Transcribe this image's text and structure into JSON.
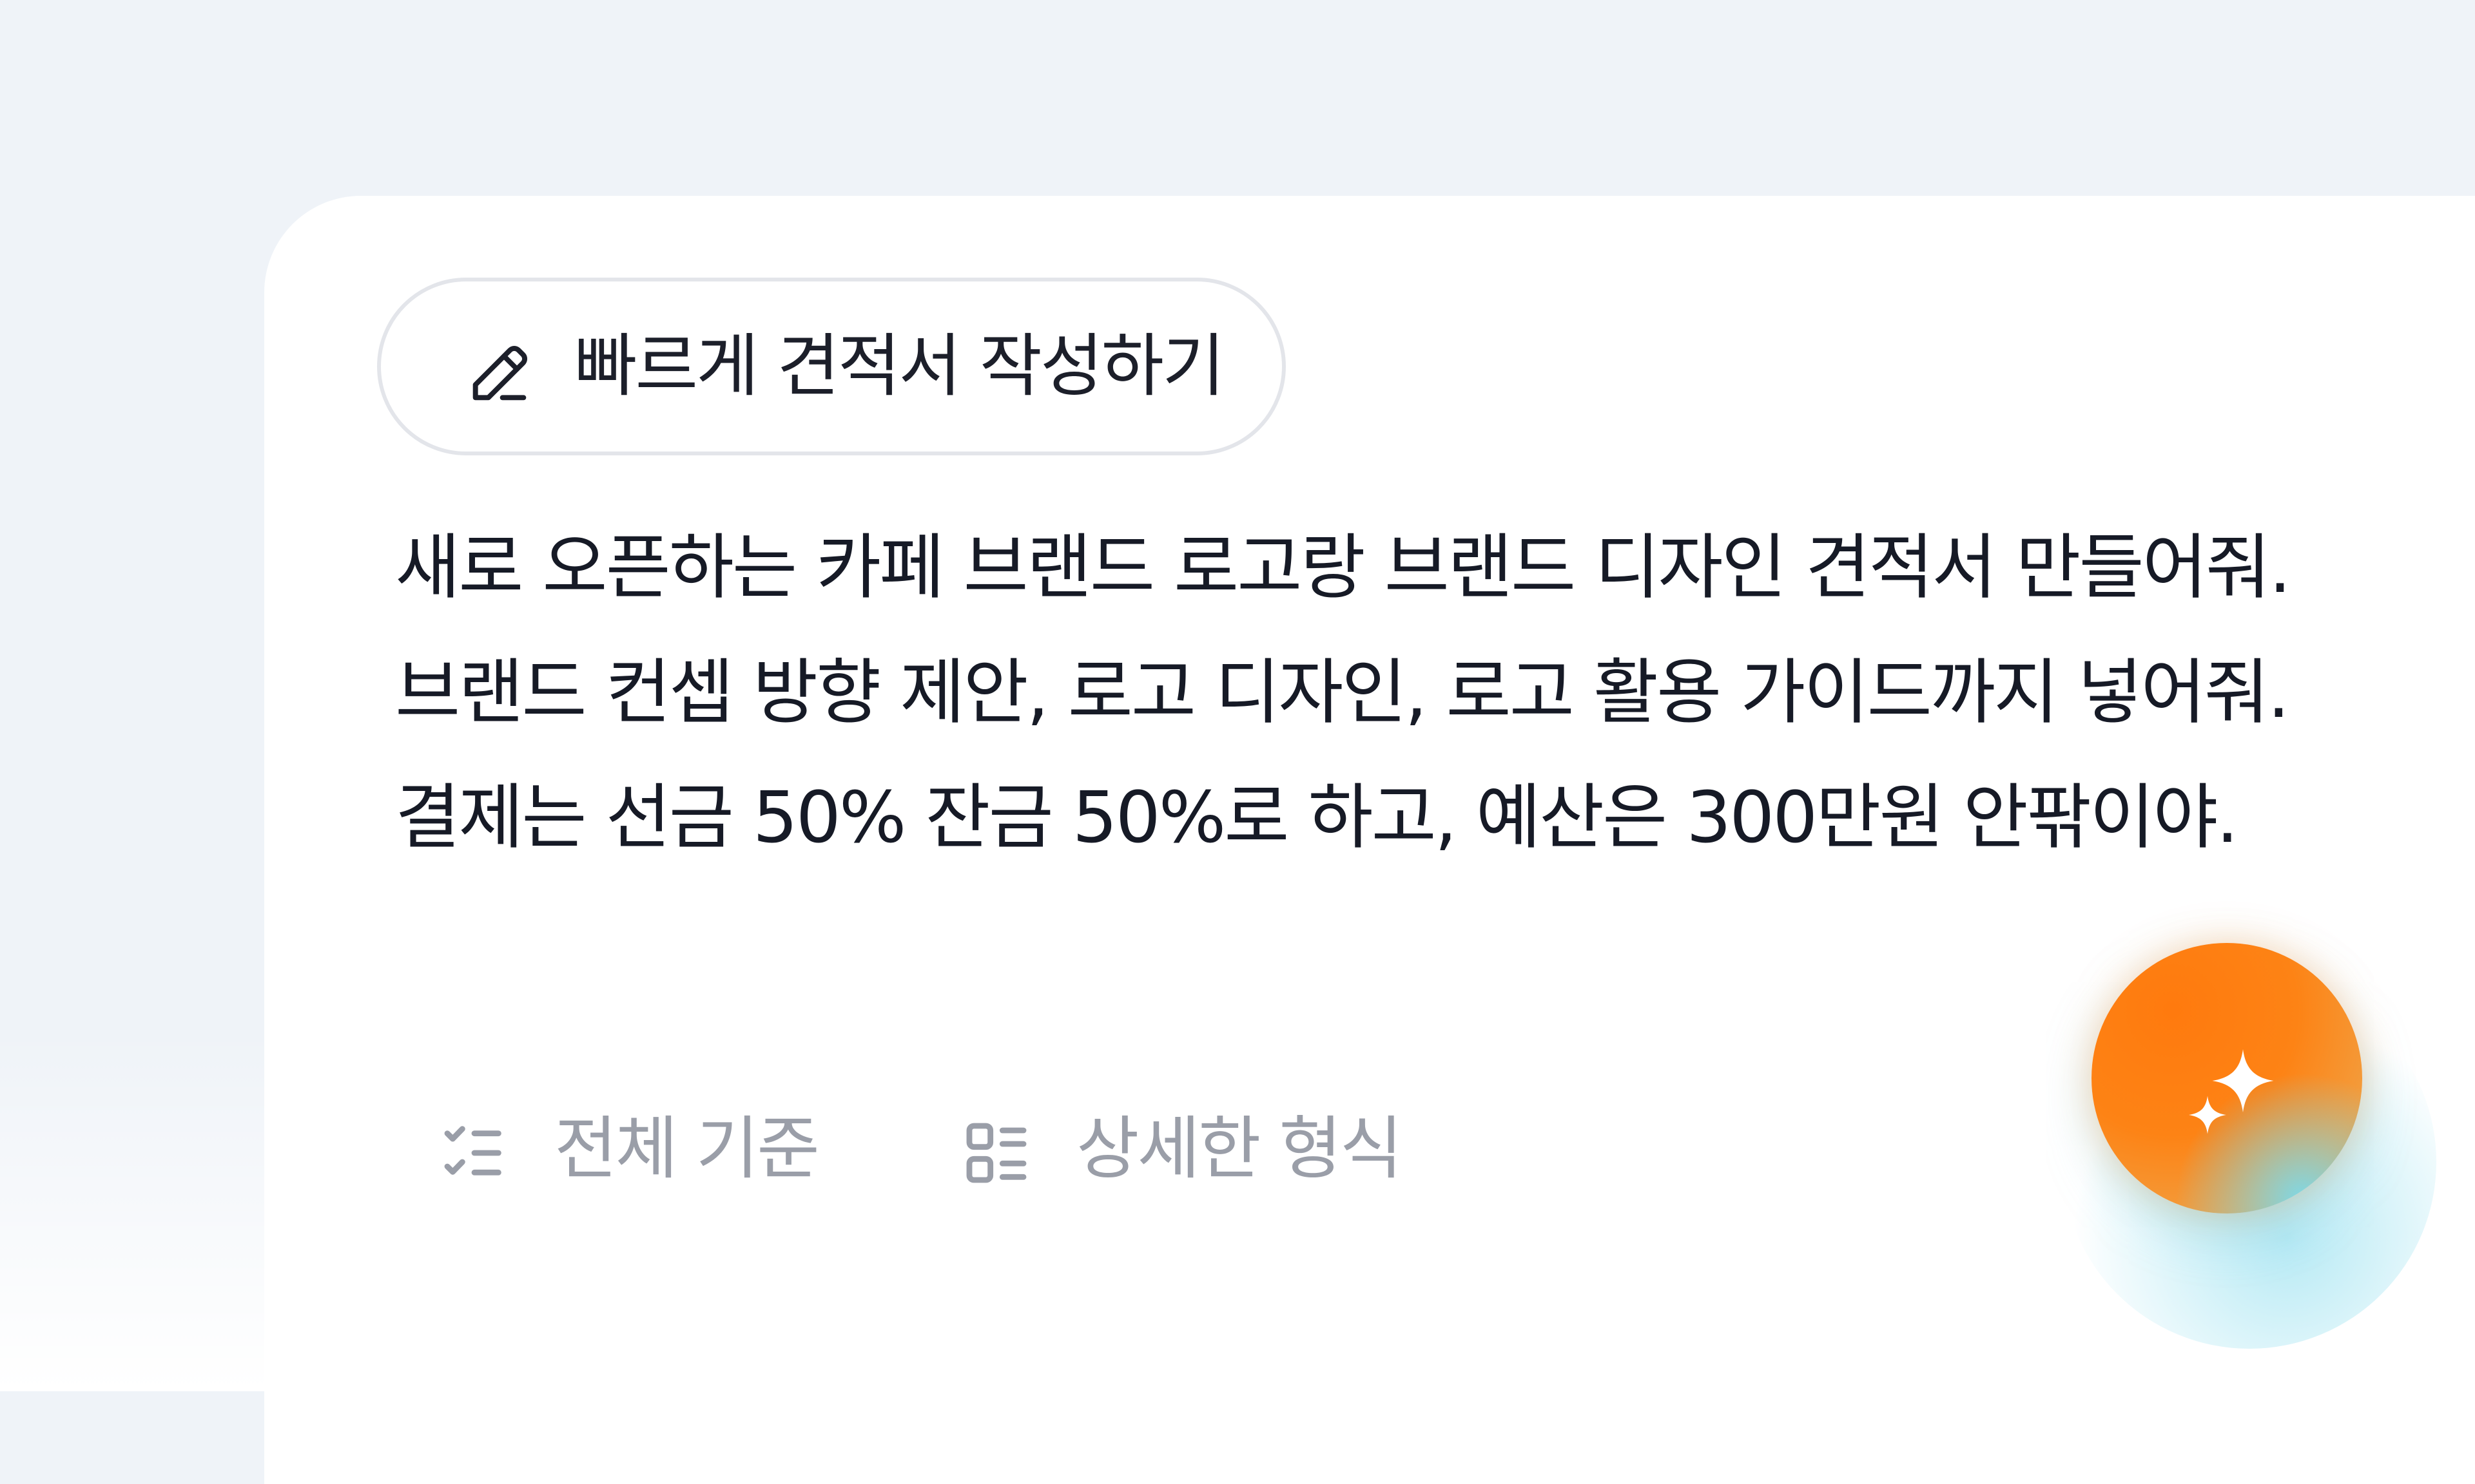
{
  "mode_chip": {
    "icon": "pencil-icon",
    "label": "빠르게 견적서 작성하기"
  },
  "prompt": {
    "lines": [
      "새로 오픈하는 카페 브랜드 로고랑 브랜드 디자인 견적서 만들어줘.",
      "브랜드 컨셉 방향 제안, 로고 디자인, 로고 활용 가이드까지 넣어줘.",
      "결제는 선금 50% 잔금 50%로 하고, 예산은 300만원 안팎이야."
    ]
  },
  "options": {
    "criteria": {
      "icon": "checklist-icon",
      "label": "전체 기준"
    },
    "format": {
      "icon": "list-detail-icon",
      "label": "상세한 형식"
    }
  },
  "generate_button": {
    "icon": "sparkle-icon",
    "colors": {
      "primary": "#ff7a0e",
      "secondary": "#7fd8e6"
    }
  },
  "colors": {
    "background": "#eff3f8",
    "card": "#ffffff",
    "text": "#161a26",
    "muted_text": "#9a9ea8",
    "chip_border": "#e3e5ea"
  }
}
